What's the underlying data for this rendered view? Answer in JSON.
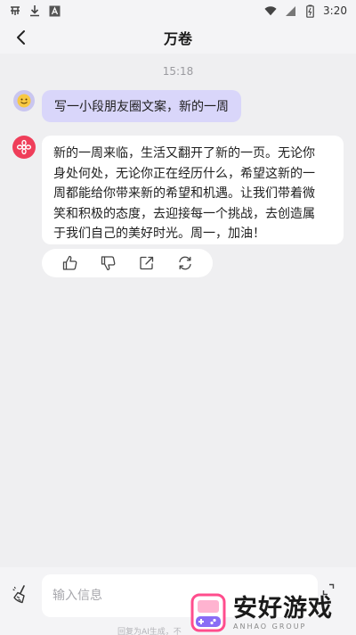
{
  "status_bar": {
    "time": "3:20",
    "icons": [
      "app-icon",
      "download-icon",
      "a-icon",
      "wifi-icon",
      "signal-icon",
      "battery-icon"
    ]
  },
  "header": {
    "title": "万卷",
    "back_icon": "chevron-left-icon"
  },
  "chat": {
    "timestamp": "15:18",
    "messages": [
      {
        "role": "user",
        "text": "写一小段朋友圈文案，新的一周"
      },
      {
        "role": "ai",
        "lines": [
          "新的一周来临，生活又翻开了新的一页。无论你",
          "身处何处，无论你正在经历什么，希望这新的一",
          "周都能给你带来新的希望和机遇。让我们带着微",
          "笑和积极的态度，去迎接每一个挑战，去创造属",
          "于我们自己的美好时光。周一，加油！"
        ]
      }
    ],
    "actions": [
      "thumbs-up-icon",
      "thumbs-down-icon",
      "share-icon",
      "regenerate-icon"
    ]
  },
  "composer": {
    "placeholder": "输入信息",
    "disclaimer": "回复为AI生成，不"
  },
  "watermark": {
    "title": "安好游戏",
    "subtitle": "ANHAO GROUP"
  },
  "colors": {
    "background": "#efeff1",
    "user_bubble": "#d9d6fa",
    "ai_avatar": "#ef3e5a",
    "user_avatar": "#c9c6f0"
  }
}
